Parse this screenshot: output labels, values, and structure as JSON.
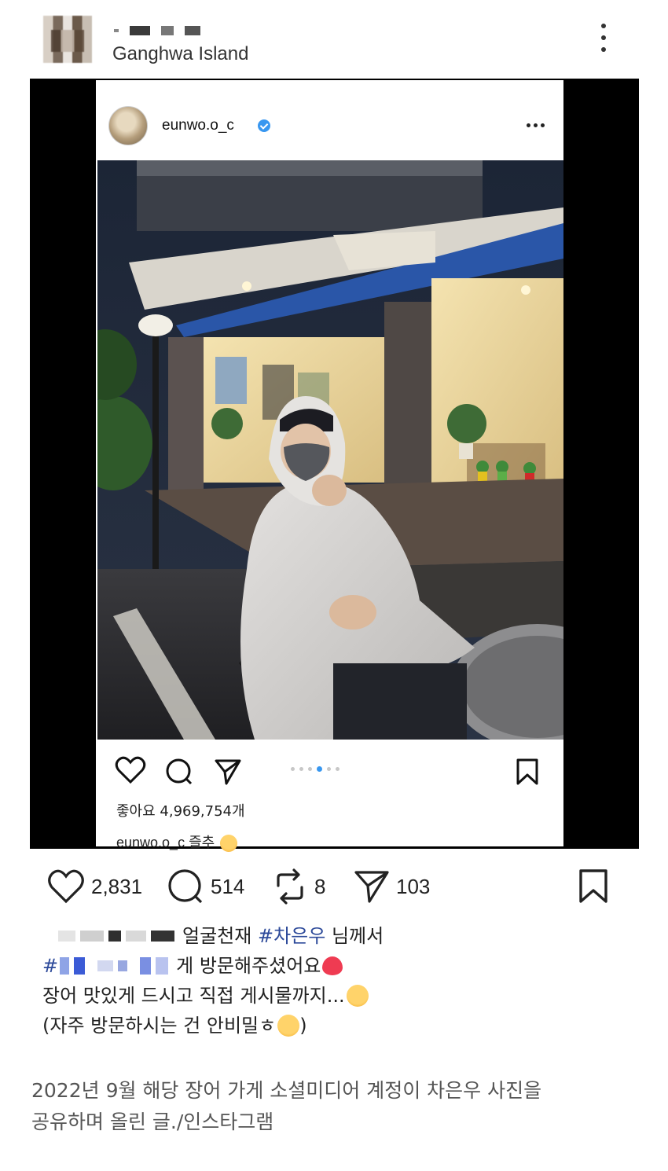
{
  "header": {
    "location": "Ganghwa Island",
    "more_icon": "more-vertical-icon"
  },
  "embedded_post": {
    "username": "eunwo.o_c",
    "verified_icon": "verified-badge-icon",
    "likes_text": "좋아요 4,969,754개",
    "caption_user": "eunwo.o_c",
    "caption_text": "즐추",
    "carousel_total": 6,
    "carousel_active": 3
  },
  "actions": {
    "likes": "2,831",
    "comments": "514",
    "reposts": "8",
    "shares": "103"
  },
  "post_text": {
    "line1_text": "얼굴천재",
    "line1_hashtag": "#차은우",
    "line1_end": "님께서",
    "line2_hash": "#",
    "line2_text": "게 방문해주셨어요",
    "line3_text": "장어 맛있게 드시고 직접 게시물까지...",
    "line4_text": "(자주 방문하시는 건 안비밀ㅎ",
    "line4_close": ")"
  },
  "footnote": {
    "line1": "2022년 9월 해당 장어 가게 소셜미디어 계정이 차은우 사진을",
    "line2": "공유하며 올린 글./인스타그램"
  },
  "colors": {
    "hashtag": "#2d4a9a",
    "verified": "#3897f0",
    "awning": "#2a56a8"
  }
}
